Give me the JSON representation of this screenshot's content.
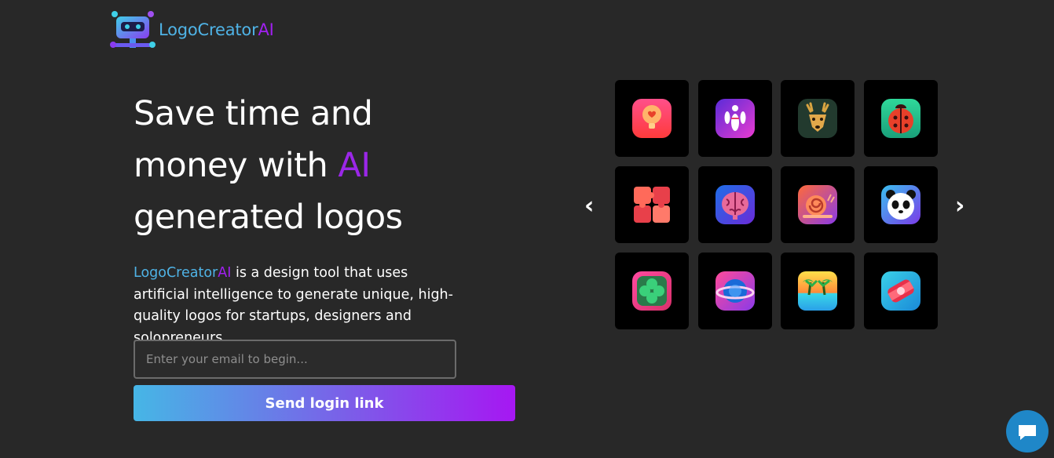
{
  "brand": {
    "part1": "LogoCreator",
    "part2": "AI"
  },
  "hero": {
    "line1": "Save time and",
    "line2_pre": "money with ",
    "line2_ai": "AI",
    "line3": "generated logos"
  },
  "description": {
    "brand_part1": "LogoCreator",
    "brand_part2": "AI",
    "text": " is a design tool that uses artificial intelligence to generate unique, high-quality logos for startups, designers and solopreneurs."
  },
  "form": {
    "email_placeholder": "Enter your email to begin...",
    "email_value": "",
    "submit_label": "Send login link"
  },
  "carousel": {
    "prev_label": "‹",
    "next_label": "›",
    "icons": [
      "lightbulb-heart-icon",
      "bowling-pins-icon",
      "deer-head-icon",
      "ladybug-icon",
      "puzzle-icon",
      "brain-icon",
      "snail-icon",
      "panda-icon",
      "clover-icon",
      "planet-icon",
      "palm-trees-icon",
      "sushi-icon"
    ]
  },
  "chat": {
    "icon": "chat-bubble-icon"
  },
  "colors": {
    "background": "#282828",
    "brand_blue": "#4fb3e6",
    "brand_purple": "#a020f0"
  }
}
